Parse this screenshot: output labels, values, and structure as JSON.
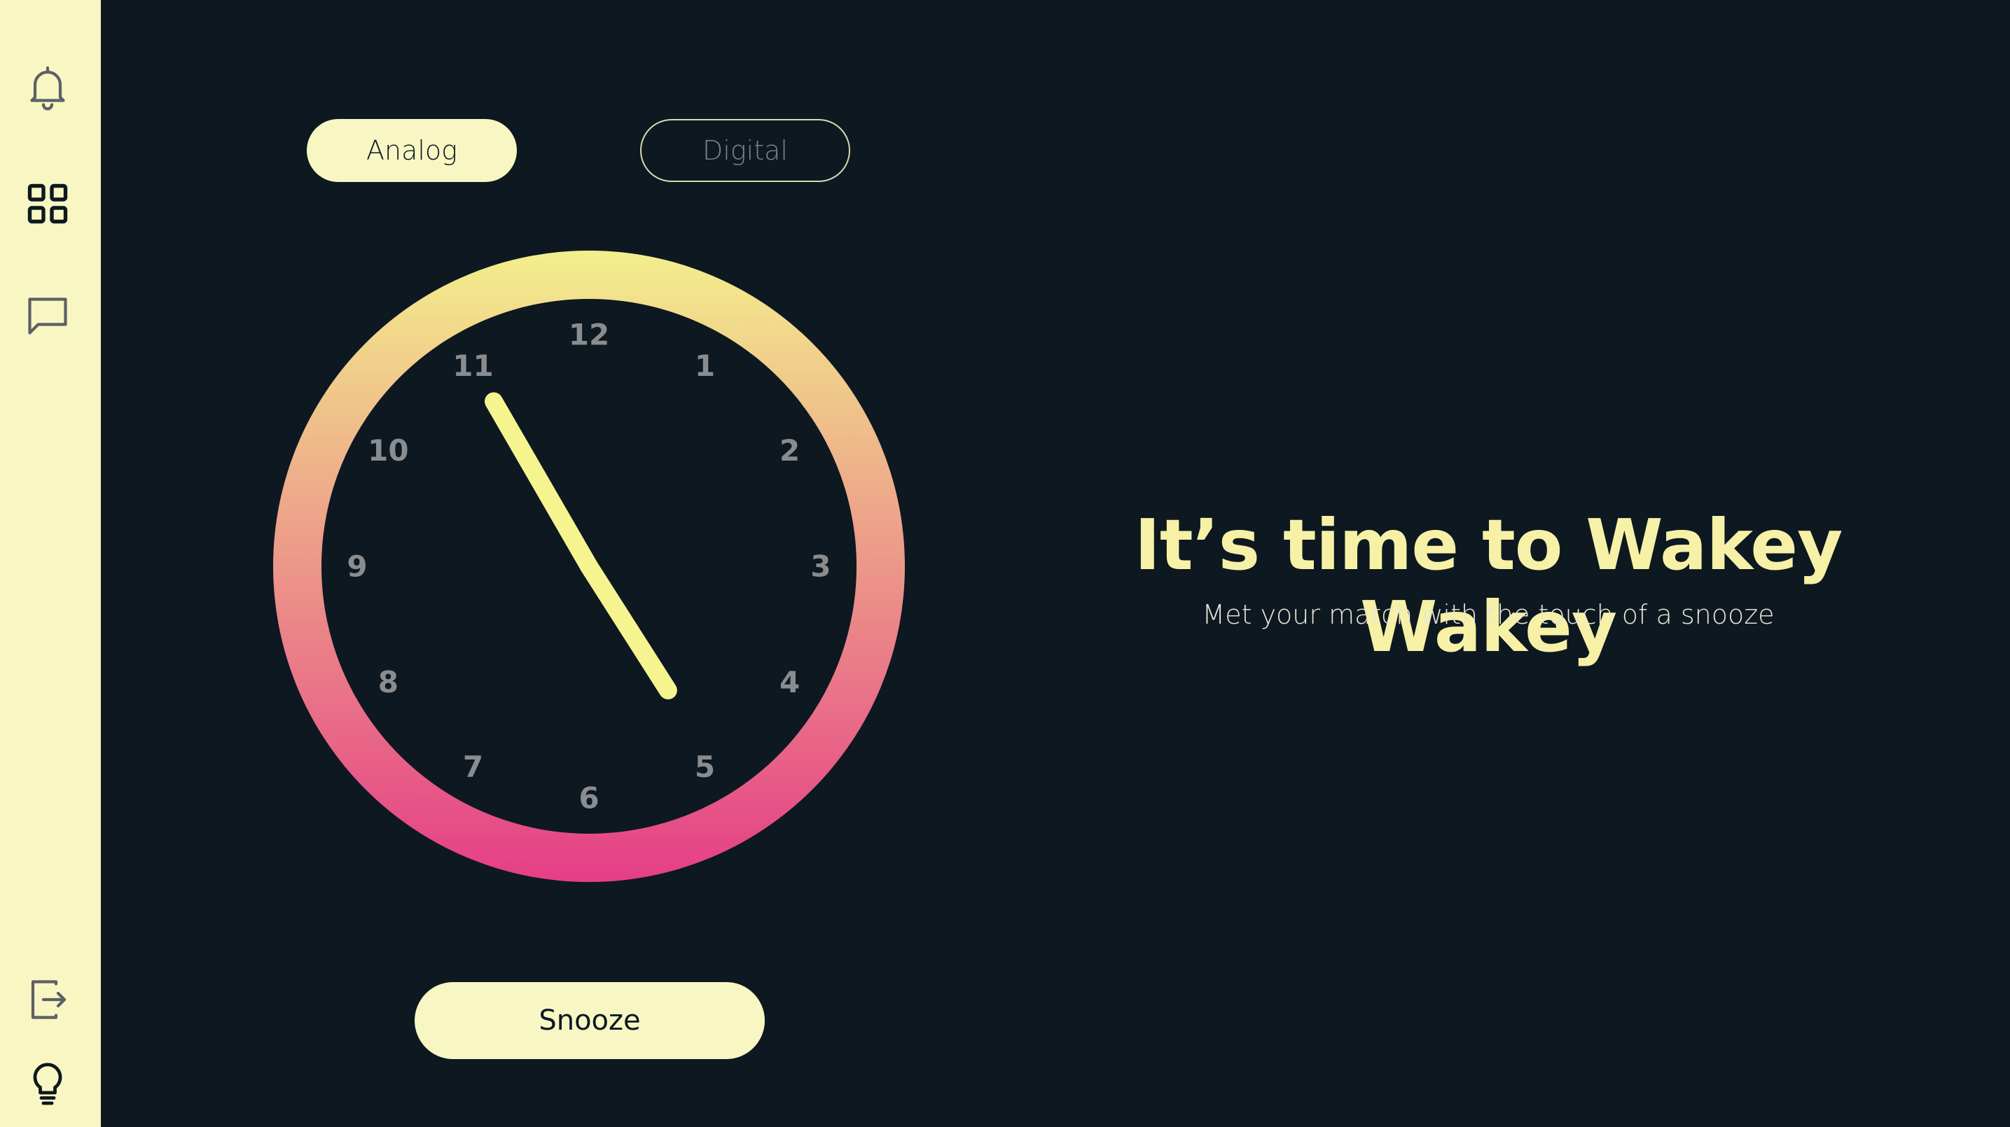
{
  "sidebar": {
    "top_icons": [
      "bell-icon",
      "grid-icon",
      "chat-icon"
    ],
    "bottom_icons": [
      "logout-icon",
      "lightbulb-icon"
    ]
  },
  "mode_toggle": {
    "analog_label": "Analog",
    "digital_label": "Digital",
    "selected": "Analog"
  },
  "clock": {
    "numbers": [
      "12",
      "1",
      "2",
      "3",
      "4",
      "5",
      "6",
      "7",
      "8",
      "9",
      "10",
      "11"
    ],
    "hour": 4,
    "minute": 55,
    "ring_gradient": [
      "#f3ef8c",
      "#e53e86"
    ],
    "hand_color": "#f6f48e",
    "number_color": "#8a8c8e"
  },
  "snooze_label": "Snooze",
  "headline": "It’s time to Wakey Wakey",
  "subline": "Met your match with the touch of a snooze",
  "colors": {
    "background": "#0d1821",
    "sidebar": "#f8f7c3",
    "accent": "#f6f1a6"
  }
}
